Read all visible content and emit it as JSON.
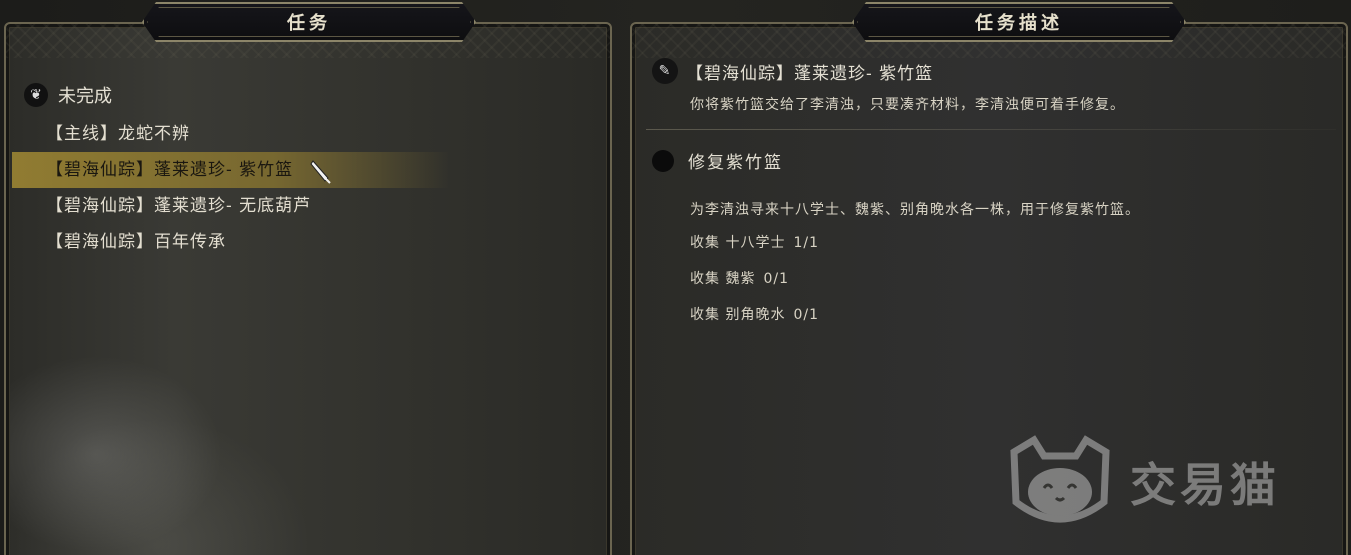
{
  "left_panel": {
    "title": "任务",
    "section": {
      "label": "未完成",
      "icon": "swirl-icon"
    },
    "quests": [
      {
        "label": "【主线】龙蛇不辨",
        "selected": false
      },
      {
        "label": "【碧海仙踪】蓬莱遗珍- 紫竹篮",
        "selected": true
      },
      {
        "label": "【碧海仙踪】蓬莱遗珍- 无底葫芦",
        "selected": false
      },
      {
        "label": "【碧海仙踪】百年传承",
        "selected": false
      }
    ]
  },
  "right_panel": {
    "title": "任务描述",
    "quest_title": "【碧海仙踪】蓬莱遗珍- 紫竹篮",
    "quest_summary": "你将紫竹篮交给了李清浊，只要凑齐材料，李清浊便可着手修复。",
    "objective_title": "修复紫竹篮",
    "objective_desc": "为李清浊寻来十八学士、魏紫、别角晚水各一株，用于修复紫竹篮。",
    "objectives": [
      {
        "label": "收集 十八学士",
        "count": "1/1"
      },
      {
        "label": "收集 魏紫",
        "count": "0/1"
      },
      {
        "label": "收集 别角晚水",
        "count": "0/1"
      }
    ]
  },
  "watermark": {
    "text": "交易猫",
    "icon": "cat-logo"
  },
  "colors": {
    "selected_highlight": "#96803a",
    "border": "#6b6550",
    "text": "#e3ded0"
  }
}
